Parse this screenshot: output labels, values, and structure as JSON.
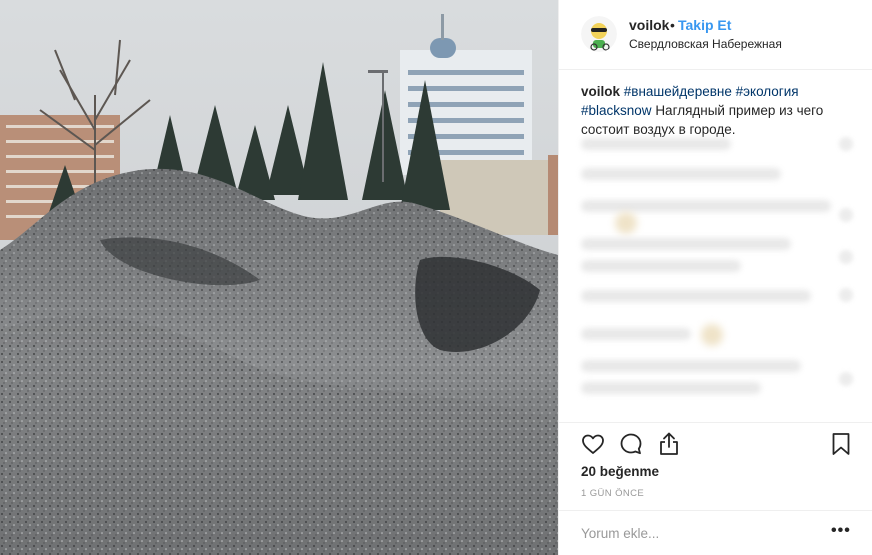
{
  "photo": {
    "icon": "photo-dirty-snow-city"
  },
  "header": {
    "username": "voilok",
    "separator": "•",
    "follow_label": "Takip Et",
    "location": "Свердловская Набережная",
    "avatar_icon": "avatar-cyclist"
  },
  "caption": {
    "username": "voilok",
    "hashtags": [
      "#внашейдеревне",
      "#экология",
      "#blacksnow"
    ],
    "text": "Наглядный пример из чего состоит воздух в городе."
  },
  "actions": {
    "like_icon": "heart-icon",
    "comment_icon": "comment-icon",
    "share_icon": "share-icon",
    "save_icon": "bookmark-icon"
  },
  "likes_label": "20 beğenme",
  "timestamp": "1 GÜN ÖNCE",
  "comment_box": {
    "placeholder": "Yorum ekle...",
    "more_label": "•••"
  },
  "colors": {
    "link": "#3897f0",
    "hashtag": "#003569",
    "text": "#262626",
    "muted": "#999999",
    "divider": "#efefef"
  }
}
